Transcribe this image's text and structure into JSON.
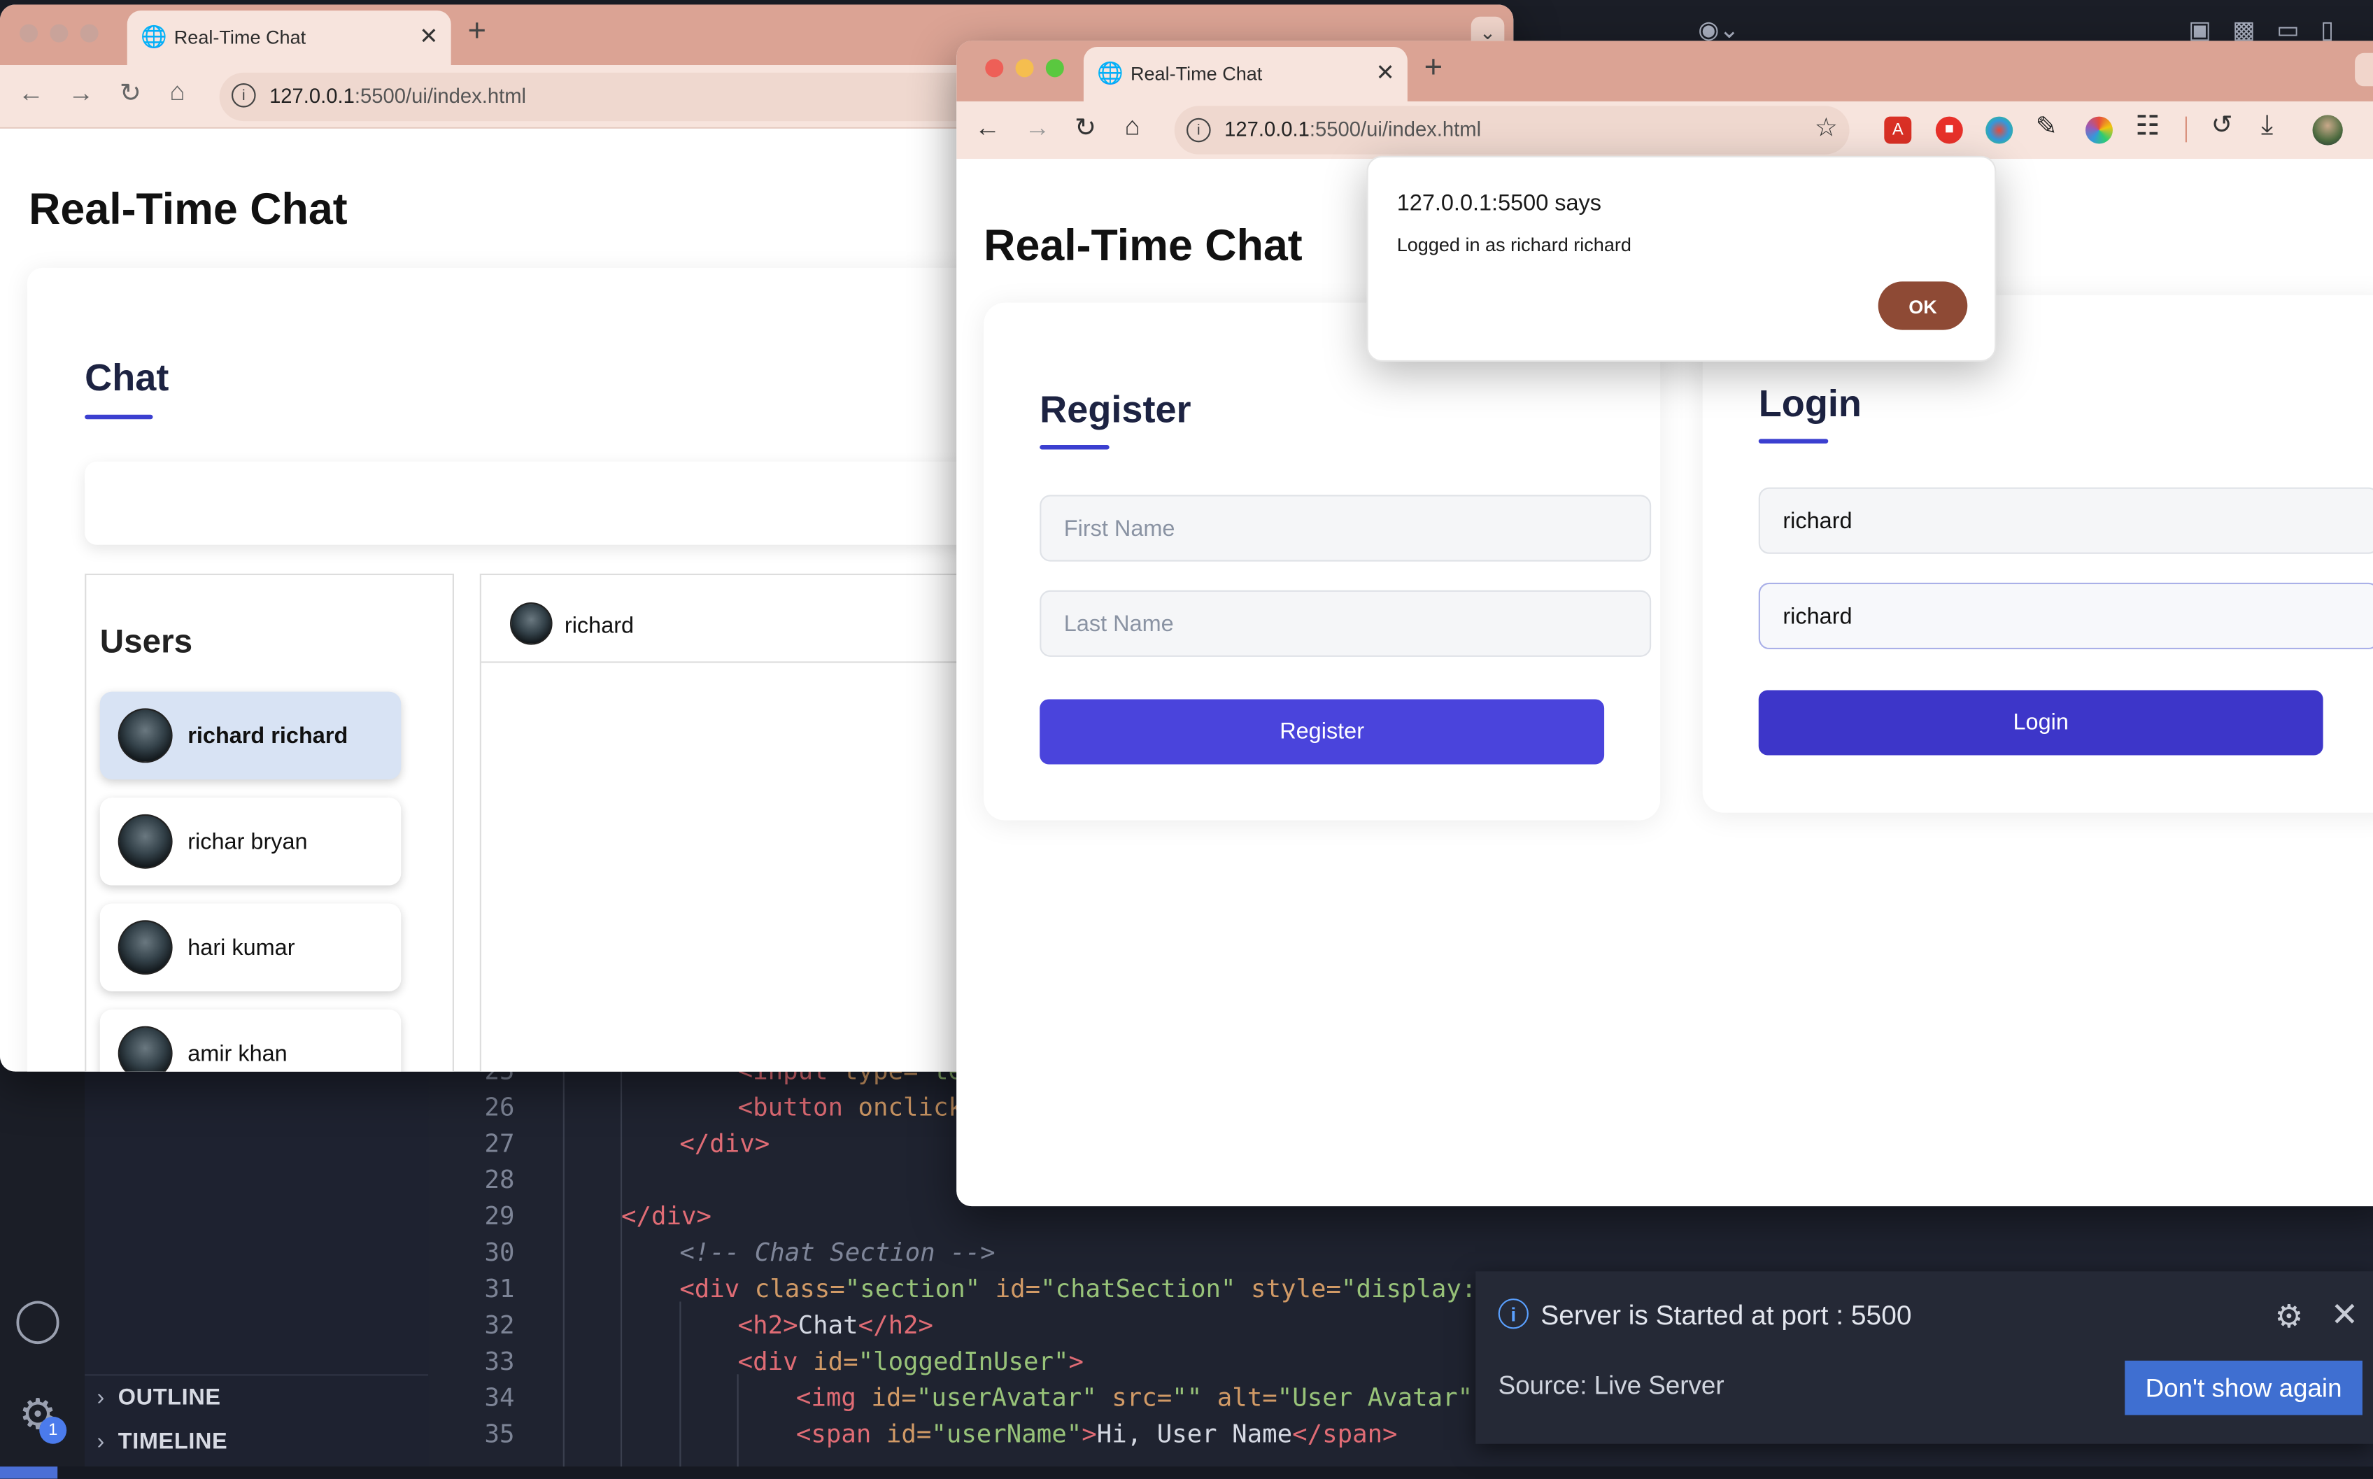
{
  "vscode": {
    "sidebar_sections": [
      {
        "label": "OUTLINE"
      },
      {
        "label": "TIMELINE"
      }
    ],
    "accounts_badge": "1",
    "code_lines": [
      {
        "num": "25",
        "indent": 3,
        "html": "<span class='tag'>&lt;input</span> <span class='attr'>type=</span><span class='str'>\"te</span>"
      },
      {
        "num": "26",
        "indent": 3,
        "html": "<span class='tag'>&lt;button</span> <span class='attr'>onclick</span>"
      },
      {
        "num": "27",
        "indent": 2,
        "html": "<span class='tag'>&lt;/div&gt;</span>"
      },
      {
        "num": "28",
        "indent": 0,
        "html": ""
      },
      {
        "num": "29",
        "indent": 1,
        "html": "<span class='tag'>&lt;/div&gt;</span>"
      },
      {
        "num": "30",
        "indent": 2,
        "html": "<span class='comment'>&lt;!-- Chat Section --&gt;</span>"
      },
      {
        "num": "31",
        "indent": 2,
        "html": "<span class='tag'>&lt;div</span> <span class='attr'>class=</span><span class='str'>\"section\"</span> <span class='attr'>id=</span><span class='str'>\"chatSection\"</span> <span class='attr'>style=</span><span class='str'>\"display: n</span>"
      },
      {
        "num": "32",
        "indent": 3,
        "html": "<span class='tag'>&lt;h2&gt;</span>Chat<span class='tag'>&lt;/h2&gt;</span>"
      },
      {
        "num": "33",
        "indent": 3,
        "html": "<span class='tag'>&lt;div</span> <span class='attr'>id=</span><span class='str'>\"loggedInUser\"</span><span class='tag'>&gt;</span>"
      },
      {
        "num": "34",
        "indent": 4,
        "html": "<span class='tag'>&lt;img</span> <span class='attr'>id=</span><span class='str'>\"userAvatar\"</span> <span class='attr'>src=</span><span class='str'>\"\"</span> <span class='attr'>alt=</span><span class='str'>\"User Avatar\"</span> /"
      },
      {
        "num": "35",
        "indent": 4,
        "html": "<span class='tag'>&lt;span</span> <span class='attr'>id=</span><span class='str'>\"userName\"</span><span class='tag'>&gt;</span>Hi, User Name<span class='tag'>&lt;/span&gt;</span>"
      }
    ],
    "toast": {
      "message": "Server is Started at port : 5500",
      "source": "Source: Live Server",
      "button": "Don't show again"
    }
  },
  "left_browser": {
    "tab_title": "Real-Time Chat",
    "url_host": "127.0.0.1",
    "url_rest": ":5500/ui/index.html",
    "page_title": "Real-Time Chat",
    "chat_heading": "Chat",
    "users_heading": "Users",
    "users": [
      {
        "name": "richard richard",
        "active": true
      },
      {
        "name": "richar bryan",
        "active": false
      },
      {
        "name": "hari kumar",
        "active": false
      },
      {
        "name": "amir khan",
        "active": false
      }
    ],
    "chat_header_name": "richard"
  },
  "right_browser": {
    "tab_title": "Real-Time Chat",
    "url_host": "127.0.0.1",
    "url_rest": ":5500/ui/index.html",
    "page_title": "Real-Time Chat",
    "register": {
      "heading": "Register",
      "first_name_placeholder": "First Name",
      "last_name_placeholder": "Last Name",
      "button": "Register"
    },
    "login": {
      "heading": "Login",
      "username_value": "richard",
      "password_value": "richard",
      "button": "Login"
    },
    "alert": {
      "title": "127.0.0.1:5500 says",
      "message": "Logged in as richard richard",
      "ok": "OK"
    }
  },
  "colors": {
    "tab_strip": "#dba394",
    "accent": "#4a44dc",
    "alert_ok": "#8e4a35",
    "toast_button": "#3f6fd1"
  }
}
